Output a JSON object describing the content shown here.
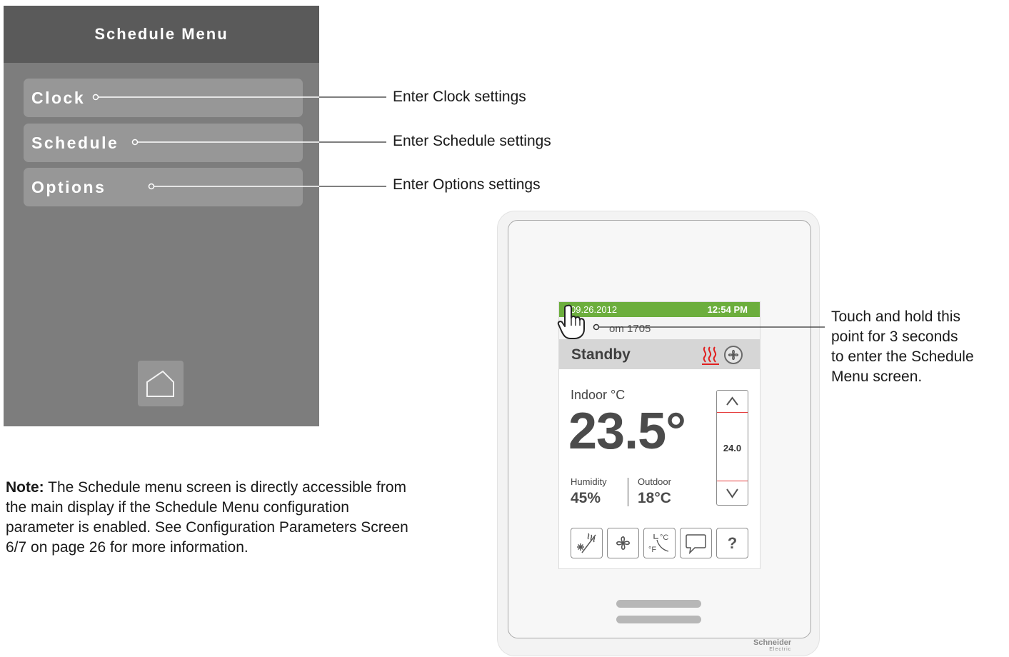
{
  "menu": {
    "title": "Schedule Menu",
    "items": [
      {
        "label": "Clock"
      },
      {
        "label": "Schedule"
      },
      {
        "label": "Options"
      }
    ],
    "home_icon": "home-icon"
  },
  "callouts": {
    "clock": "Enter Clock settings",
    "schedule": "Enter Schedule settings",
    "options": "Enter Options settings",
    "touch_lines": [
      "Touch and hold this",
      "point for 3 seconds",
      "to enter the Schedule",
      "Menu screen."
    ]
  },
  "note": {
    "bold": "Note:",
    "text": " The Schedule menu screen is directly accessible from the main display if the Schedule Menu configuration parameter is enabled. See Configuration Parameters Screen 6/7 on page 26 for more information."
  },
  "thermostat": {
    "date": "09.26.2012",
    "time": "12:54 PM",
    "room": "om 1705",
    "mode": "Standby",
    "indoor_label": "Indoor °C",
    "indoor_temp": "23.5°",
    "humidity_label": "Humidity",
    "humidity_value": "45%",
    "outdoor_label": "Outdoor",
    "outdoor_value": "18°C",
    "setpoint": "24.0",
    "help_label": "?",
    "brand_name": "Schneider",
    "brand_sub": "Electric",
    "icons": [
      "heating-icon",
      "fan-status-icon",
      "mode-icon",
      "fan-icon",
      "units-icon",
      "message-icon",
      "help-icon",
      "hand-pointer-icon"
    ],
    "colors": {
      "status_bar": "#6cae3d",
      "heat": "#e02020",
      "setpoint_line": "#e53b3b"
    }
  }
}
